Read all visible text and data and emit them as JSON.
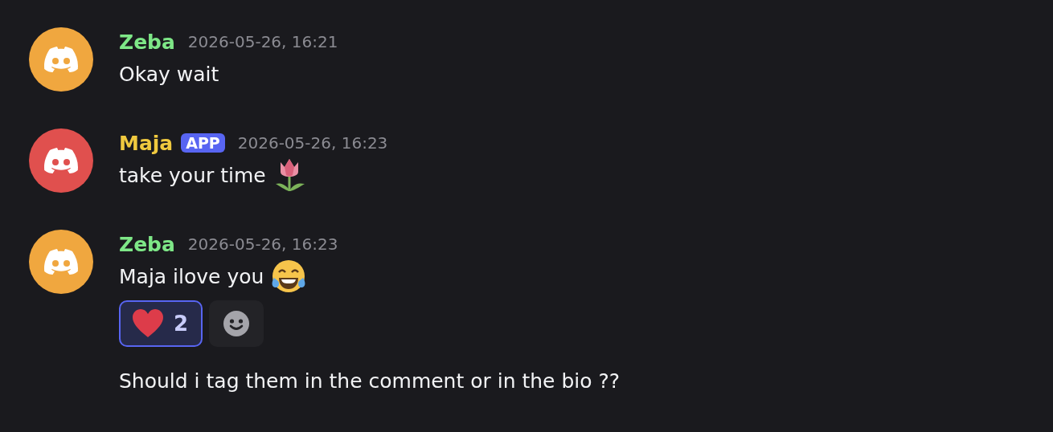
{
  "messages": [
    {
      "kind": "full",
      "author": {
        "name": "Zeba",
        "color": "#7ee787"
      },
      "avatar": {
        "color": "#f0a73f"
      },
      "timestamp": "2026-05-26, 16:21",
      "text": "Okay wait"
    },
    {
      "kind": "full",
      "author": {
        "name": "Maja",
        "color": "#f0c93f"
      },
      "avatar": {
        "color": "#e0504e"
      },
      "badge": "APP",
      "timestamp": "2026-05-26, 16:23",
      "text": "take your time",
      "emoji": {
        "kind": "tulip"
      }
    },
    {
      "kind": "full",
      "author": {
        "name": "Zeba",
        "color": "#7ee787"
      },
      "avatar": {
        "color": "#f0a73f"
      },
      "timestamp": "2026-05-26, 16:23",
      "text": "Maja ilove you",
      "emoji": {
        "kind": "laughing"
      },
      "reactions": [
        {
          "kind": "heart",
          "count": "2",
          "selected": true
        }
      ],
      "add_reaction": true
    },
    {
      "kind": "continuation",
      "text": "Should i tag them in the comment or in the bio ??"
    }
  ]
}
